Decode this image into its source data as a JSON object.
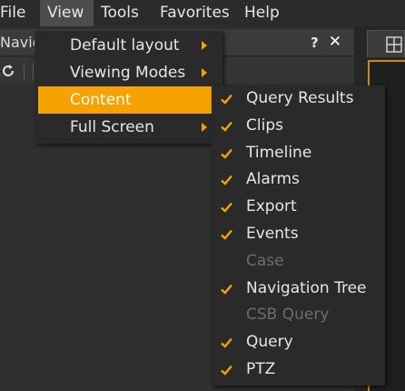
{
  "menubar": {
    "items": [
      {
        "label": "File"
      },
      {
        "label": "View"
      },
      {
        "label": "Tools"
      },
      {
        "label": "Favorites"
      },
      {
        "label": "Help"
      }
    ]
  },
  "panel": {
    "title": "Navig",
    "help_label": "?",
    "close_label": "✕"
  },
  "view_menu": {
    "items": [
      {
        "label": "Default layout"
      },
      {
        "label": "Viewing Modes"
      },
      {
        "label": "Content"
      },
      {
        "label": "Full Screen"
      }
    ]
  },
  "content_menu": {
    "items": [
      {
        "label": "Query Results",
        "checked": true,
        "enabled": true
      },
      {
        "label": "Clips",
        "checked": true,
        "enabled": true
      },
      {
        "label": "Timeline",
        "checked": true,
        "enabled": true
      },
      {
        "label": "Alarms",
        "checked": true,
        "enabled": true
      },
      {
        "label": "Export",
        "checked": true,
        "enabled": true
      },
      {
        "label": "Events",
        "checked": true,
        "enabled": true
      },
      {
        "label": "Case",
        "checked": false,
        "enabled": false
      },
      {
        "label": "Navigation Tree",
        "checked": true,
        "enabled": true
      },
      {
        "label": "CSB Query",
        "checked": false,
        "enabled": false
      },
      {
        "label": "Query",
        "checked": true,
        "enabled": true
      },
      {
        "label": "PTZ",
        "checked": true,
        "enabled": true
      }
    ]
  },
  "colors": {
    "accent": "#f5a202",
    "menu_bg": "#2a2a2a",
    "disabled_text": "#6d6d6d"
  }
}
